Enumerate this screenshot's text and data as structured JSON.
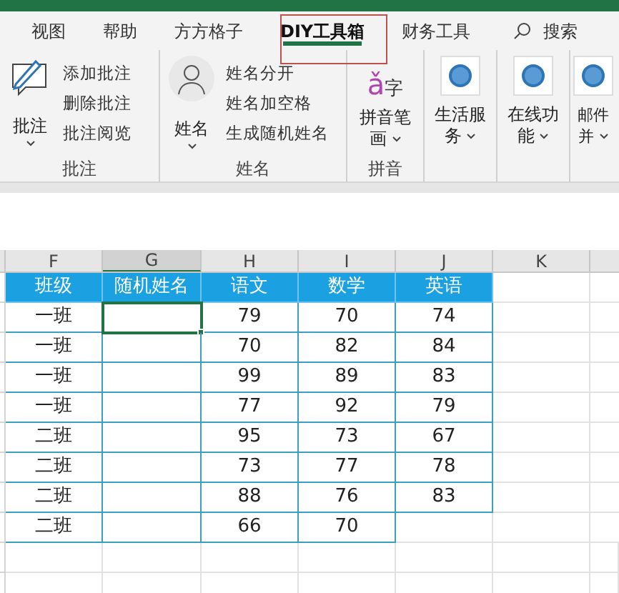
{
  "tabs": [
    {
      "label": "视图",
      "selected": false
    },
    {
      "label": "帮助",
      "selected": false
    },
    {
      "label": "方方格子",
      "selected": false
    },
    {
      "label": "DIY工具箱",
      "selected": true
    },
    {
      "label": "财务工具",
      "selected": false
    }
  ],
  "search": {
    "label": "搜索"
  },
  "ribbon": {
    "groups": [
      {
        "kind": "comment",
        "label": "批注",
        "button": [
          "批注"
        ],
        "items": [
          "添加批注",
          "删除批注",
          "批注阅览"
        ]
      },
      {
        "kind": "name",
        "label": "姓名",
        "button": [
          "姓名"
        ],
        "items": [
          "姓名分开",
          "姓名加空格",
          "生成随机姓名"
        ]
      },
      {
        "kind": "pinyin",
        "label": "拼音",
        "icon_text": [
          "ǎ",
          "字"
        ],
        "button": [
          "拼音笔",
          "画"
        ]
      },
      {
        "kind": "service",
        "button": [
          "生活服",
          "务"
        ]
      },
      {
        "kind": "service",
        "button": [
          "在线功",
          "能"
        ]
      },
      {
        "kind": "service",
        "button": [
          "邮件",
          "并"
        ]
      }
    ]
  },
  "sheet": {
    "columns": [
      {
        "label": "F",
        "selected": false
      },
      {
        "label": "G",
        "selected": true
      },
      {
        "label": "H",
        "selected": false
      },
      {
        "label": "I",
        "selected": false
      },
      {
        "label": "J",
        "selected": false
      },
      {
        "label": "K",
        "selected": false
      }
    ],
    "header": [
      "班级",
      "随机姓名",
      "语文",
      "数学",
      "英语"
    ],
    "rows": [
      {
        "class": "一班",
        "selected": true,
        "scores": [
          "79",
          "70",
          "74"
        ]
      },
      {
        "class": "一班",
        "selected": false,
        "scores": [
          "70",
          "82",
          "84"
        ]
      },
      {
        "class": "一班",
        "selected": false,
        "scores": [
          "99",
          "89",
          "83"
        ]
      },
      {
        "class": "一班",
        "selected": false,
        "scores": [
          "77",
          "92",
          "79"
        ]
      },
      {
        "class": "二班",
        "selected": false,
        "scores": [
          "95",
          "73",
          "67"
        ]
      },
      {
        "class": "二班",
        "selected": false,
        "scores": [
          "73",
          "77",
          "78"
        ]
      },
      {
        "class": "二班",
        "selected": false,
        "scores": [
          "88",
          "76",
          "83"
        ]
      },
      {
        "class": "二班",
        "selected": false,
        "scores": [
          "66",
          "70"
        ]
      }
    ]
  }
}
